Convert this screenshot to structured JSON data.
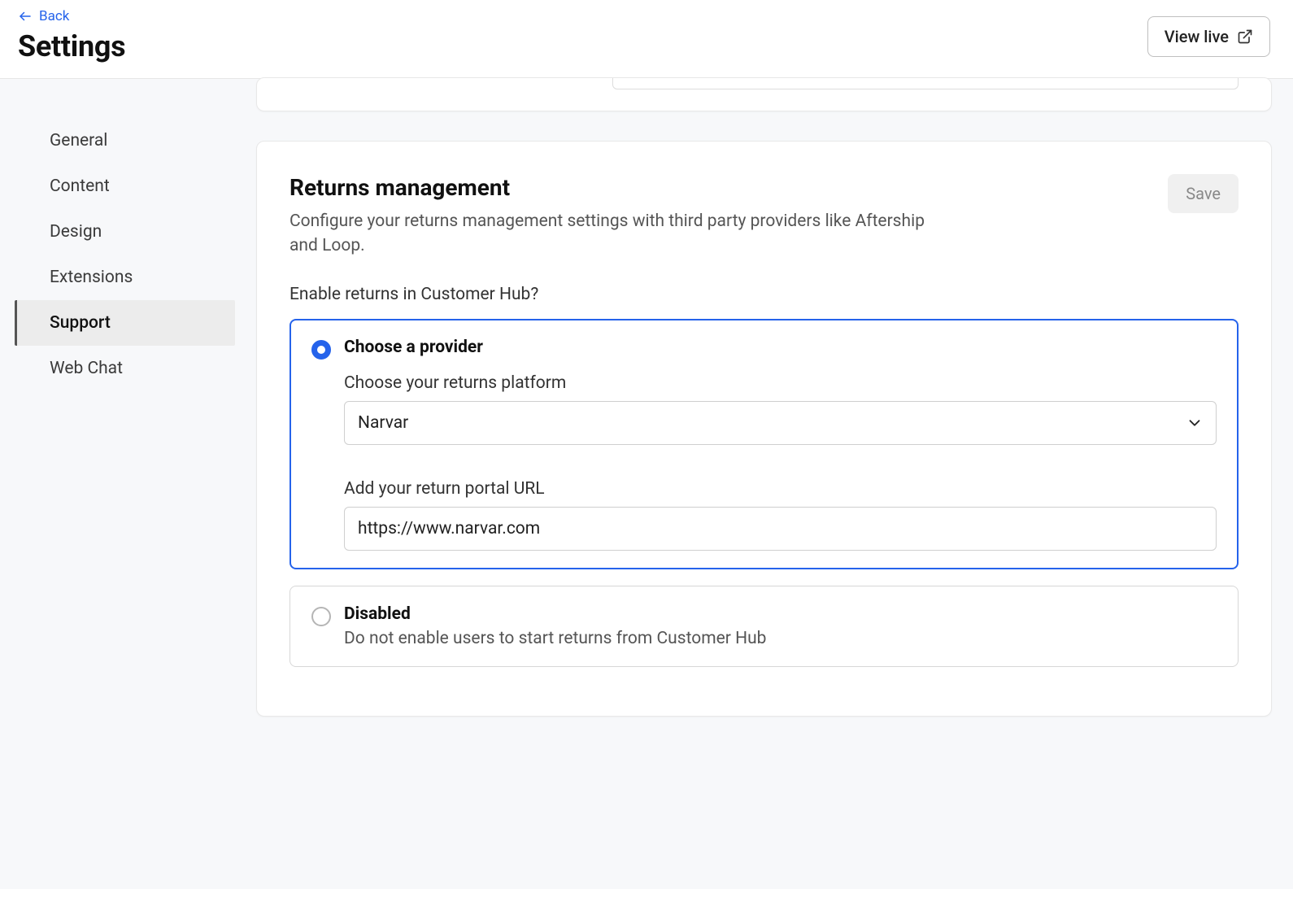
{
  "header": {
    "back": "Back",
    "title": "Settings",
    "view_live": "View live"
  },
  "sidebar": {
    "items": [
      {
        "label": "General",
        "active": false
      },
      {
        "label": "Content",
        "active": false
      },
      {
        "label": "Design",
        "active": false
      },
      {
        "label": "Extensions",
        "active": false
      },
      {
        "label": "Support",
        "active": true
      },
      {
        "label": "Web Chat",
        "active": false
      }
    ]
  },
  "returns": {
    "title": "Returns management",
    "desc": "Configure your returns management settings with third party providers like Aftership and Loop.",
    "save": "Save",
    "enable_label": "Enable returns in Customer Hub?",
    "provider_option": {
      "title": "Choose a provider",
      "platform_label": "Choose your returns platform",
      "platform_value": "Narvar",
      "url_label": "Add your return portal URL",
      "url_value": "https://www.narvar.com"
    },
    "disabled_option": {
      "title": "Disabled",
      "sub": "Do not enable users to start returns from Customer Hub"
    }
  }
}
